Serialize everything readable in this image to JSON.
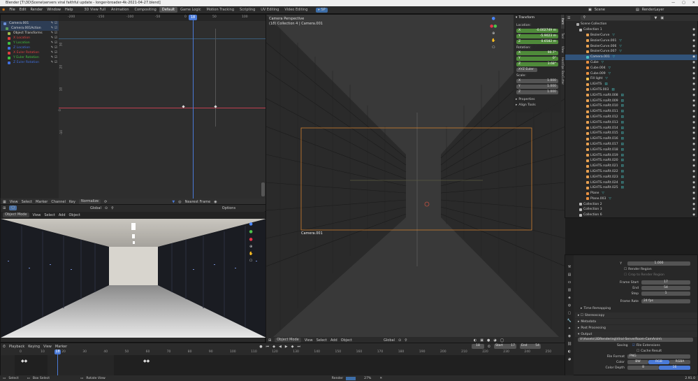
{
  "title": "Blender [T:\\3D\\Scene\\servers viral faithful update - longer-broader-4k-2021-04-27.blend]",
  "window_buttons": [
    "—",
    "▢",
    "✕"
  ],
  "menu": [
    "File",
    "Edit",
    "Render",
    "Window",
    "Help"
  ],
  "workspaces": [
    "3D View Full",
    "Animation",
    "Compositing",
    "Default",
    "Game Logic",
    "Motion Tracking",
    "Scripting",
    "UV Editing",
    "Video Editing"
  ],
  "active_workspace": "Default",
  "scene": {
    "label": "Scene",
    "render_layer": "RenderLayer"
  },
  "graph": {
    "channels": [
      {
        "label": "Camera.001",
        "color": "#6b8fd6"
      },
      {
        "label": "Camera.001Action",
        "color": "#5a9c5a"
      },
      {
        "label": "Object Transforms",
        "color": "#a0c050"
      },
      {
        "label": "X Location",
        "color": "#e04040"
      },
      {
        "label": "Y Location",
        "color": "#40c040"
      },
      {
        "label": "Z Location",
        "color": "#4070e0"
      },
      {
        "label": "X Euler Rotation",
        "color": "#e04040"
      },
      {
        "label": "Y Euler Rotation",
        "color": "#40c040"
      },
      {
        "label": "Z Euler Rotation",
        "color": "#4070e0"
      }
    ],
    "top_ticks": [
      "-200",
      "-150",
      "-100",
      "-50",
      "0",
      "50",
      "100"
    ],
    "current_frame": "18",
    "side_ticks": [
      "30",
      "20",
      "10",
      "0",
      "-10"
    ],
    "menu": [
      "View",
      "Select",
      "Marker",
      "Channel",
      "Key"
    ],
    "normalize": "Normalize",
    "nearest_frame": "Nearest Frame"
  },
  "render_view": {
    "mode": "Object Mode",
    "menu": [
      "View",
      "Select",
      "Add",
      "Object"
    ],
    "global": "Global",
    "options": "Options"
  },
  "main_view": {
    "title": "Camera Perspective",
    "subtitle": "(18) Collection 4 | Camera.001",
    "camera_label": "Camera.001",
    "mode": "Object Mode",
    "menu": [
      "View",
      "Select",
      "Add",
      "Object"
    ],
    "global": "Global"
  },
  "npanel": {
    "transform": "Transform",
    "location": "Location:",
    "loc": [
      {
        "axis": "X",
        "val": "-0.002749 m"
      },
      {
        "axis": "Y",
        "val": "-5.9023 m"
      },
      {
        "axis": "Z",
        "val": "0.6582 m"
      }
    ],
    "rotation": "Rotation:",
    "rot": [
      {
        "axis": "X",
        "val": "90.7°"
      },
      {
        "axis": "Y",
        "val": "0°"
      },
      {
        "axis": "Z",
        "val": "3.68°"
      }
    ],
    "euler": "XYZ Euler",
    "scale": "Scale:",
    "scl": [
      {
        "axis": "X",
        "val": "1.000"
      },
      {
        "axis": "Y",
        "val": "1.000"
      },
      {
        "axis": "Z",
        "val": "1.000"
      }
    ],
    "properties": "Properties",
    "align_tools": "Align Tools",
    "tabs": [
      "Item",
      "Tool",
      "View",
      "HardOps",
      "BoxCutter"
    ]
  },
  "outliner": {
    "scene_collection": "Scene Collection",
    "items": [
      "Collection 1",
      "BezierCurve",
      "BezierCurve.001",
      "BezierCurve.006",
      "BezierCurve.007",
      "Camera.001",
      "Cube",
      "Cube.004",
      "Cube.009",
      "Fill light",
      "LIGHTS",
      "LIGHTS.003",
      "LIGHTS.rsaRt.008",
      "LIGHTS.rsaRt.009",
      "LIGHTS.rsaRt.010",
      "LIGHTS.rsaRt.011",
      "LIGHTS.rsaRt.012",
      "LIGHTS.rsaRt.013",
      "LIGHTS.rsaRt.014",
      "LIGHTS.rsaRt.015",
      "LIGHTS.rsaRt.016",
      "LIGHTS.rsaRt.017",
      "LIGHTS.rsaRt.018",
      "LIGHTS.rsaRt.019",
      "LIGHTS.rsaRt.020",
      "LIGHTS.rsaRt.021",
      "LIGHTS.rsaRt.022",
      "LIGHTS.rsaRt.023",
      "LIGHTS.rsaRt.024",
      "LIGHTS.rsaRt.025",
      "Plane",
      "Plane.003",
      "Collection 2",
      "Collection 3",
      "Collection 6"
    ]
  },
  "properties": {
    "y_label": "Y",
    "y_val": "1.000",
    "render_region": "Render Region",
    "crop": "Crop to Render Region",
    "frame_start_label": "Frame Start",
    "frame_start": "17",
    "end_label": "End",
    "end": "54",
    "step_label": "Step",
    "step": "1",
    "frame_rate_label": "Frame Rate",
    "frame_rate": "24 fps",
    "time_remap": "Time Remapping",
    "stereoscopy": "Stereoscopy",
    "metadata": "Metadata",
    "post_processing": "Post Processing",
    "output": "Output",
    "path": "V:\\Assets\\3DRendering\\Viral-ServerRoom-CamAnim\\",
    "saving_label": "Saving",
    "file_ext": "File Extensions",
    "cache": "Cache Result",
    "file_format_label": "File Format",
    "file_format": "PNG",
    "color_label": "Color",
    "color_opts": [
      "BW",
      "RGB",
      "RGBA"
    ],
    "color_active": "RGB",
    "depth_label": "Color Depth",
    "depth_opts": [
      "8",
      "16"
    ]
  },
  "timeline": {
    "menu": [
      "Playback",
      "Keying",
      "View",
      "Marker"
    ],
    "current": "18",
    "start_label": "Start",
    "start": "17",
    "end_label": "End",
    "end": "54",
    "ticks": [
      "0",
      "10",
      "20",
      "30",
      "40",
      "50",
      "60",
      "70",
      "80",
      "90",
      "100",
      "110",
      "120",
      "130",
      "140",
      "150",
      "160",
      "170",
      "180",
      "190",
      "200",
      "210",
      "220",
      "230",
      "240",
      "250"
    ]
  },
  "status": {
    "select": "Select",
    "box": "Box Select",
    "rotate": "Rotate View",
    "render": "Render",
    "pct": "27%",
    "version": "2.91.0"
  }
}
